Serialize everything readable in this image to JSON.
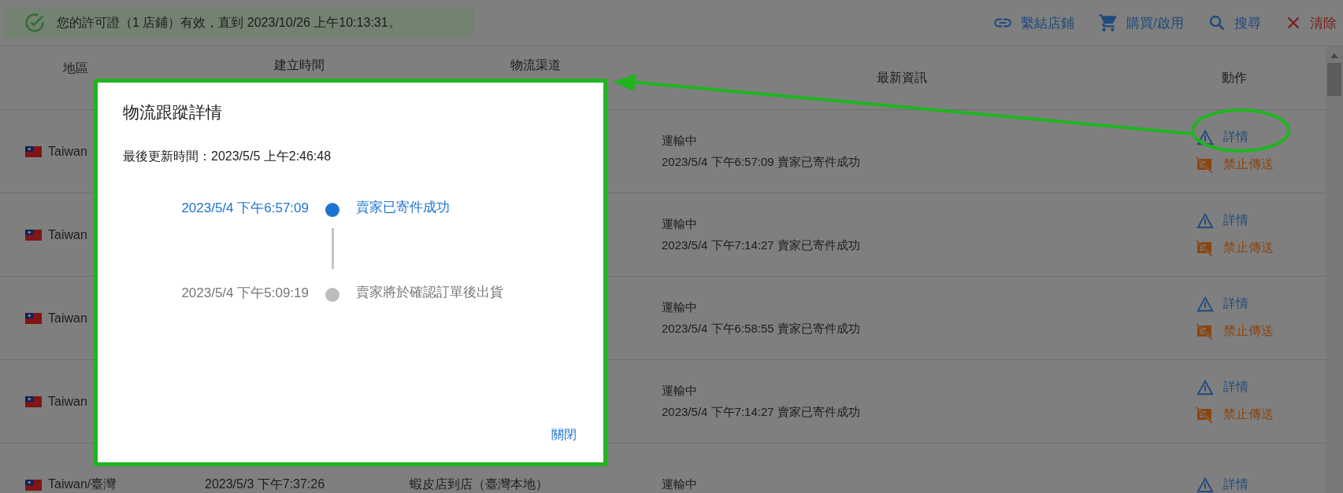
{
  "license_banner": {
    "text": "您的許可證（1 店鋪）有效，直到 2023/10/26 上午10:13:31。"
  },
  "toolbar": [
    {
      "kind": "link",
      "label": "繫結店鋪"
    },
    {
      "kind": "cart",
      "label": "購買/啟用"
    },
    {
      "kind": "search",
      "label": "搜尋"
    },
    {
      "kind": "clear",
      "label": "清除"
    }
  ],
  "table": {
    "columns": [
      "地區",
      "建立時間",
      "物流渠道",
      "最新資訊",
      "動作"
    ],
    "rows": [
      {
        "region": "Taiwan",
        "status": "運輸中",
        "latest": "2023/5/4 下午6:57:09 賣家已寄件成功",
        "actions": [
          {
            "kind": "details",
            "label": "詳情"
          },
          {
            "kind": "block",
            "label": "禁止傳送"
          }
        ]
      },
      {
        "region": "Taiwan",
        "status": "運輸中",
        "latest": "2023/5/4 下午7:14:27 賣家已寄件成功",
        "actions": [
          {
            "kind": "details",
            "label": "詳情"
          },
          {
            "kind": "block",
            "label": "禁止傳送"
          }
        ]
      },
      {
        "region": "Taiwan",
        "status": "運輸中",
        "latest": "2023/5/4 下午6:58:55 賣家已寄件成功",
        "actions": [
          {
            "kind": "details",
            "label": "詳情"
          },
          {
            "kind": "block",
            "label": "禁止傳送"
          }
        ]
      },
      {
        "region": "Taiwan",
        "status": "運輸中",
        "latest": "2023/5/4 下午7:14:27 賣家已寄件成功",
        "actions": [
          {
            "kind": "details",
            "label": "詳情"
          },
          {
            "kind": "block",
            "label": "禁止傳送"
          }
        ]
      },
      {
        "region": "Taiwan/臺灣",
        "created": "2023/5/3 下午7:37:26",
        "channel": "蝦皮店到店（臺灣本地）",
        "status": "運輸中",
        "actions": [
          {
            "kind": "details",
            "label": "詳情"
          }
        ]
      }
    ]
  },
  "dialog": {
    "title": "物流跟蹤詳情",
    "last_updated": "最後更新時間：2023/5/5 上午2:46:48",
    "events": [
      {
        "time": "2023/5/4 下午6:57:09",
        "description": "賣家已寄件成功",
        "current": true
      },
      {
        "time": "2023/5/4 下午5:09:19",
        "description": "賣家將於確認訂單後出貨",
        "current": false
      }
    ],
    "close_label": "關閉"
  }
}
